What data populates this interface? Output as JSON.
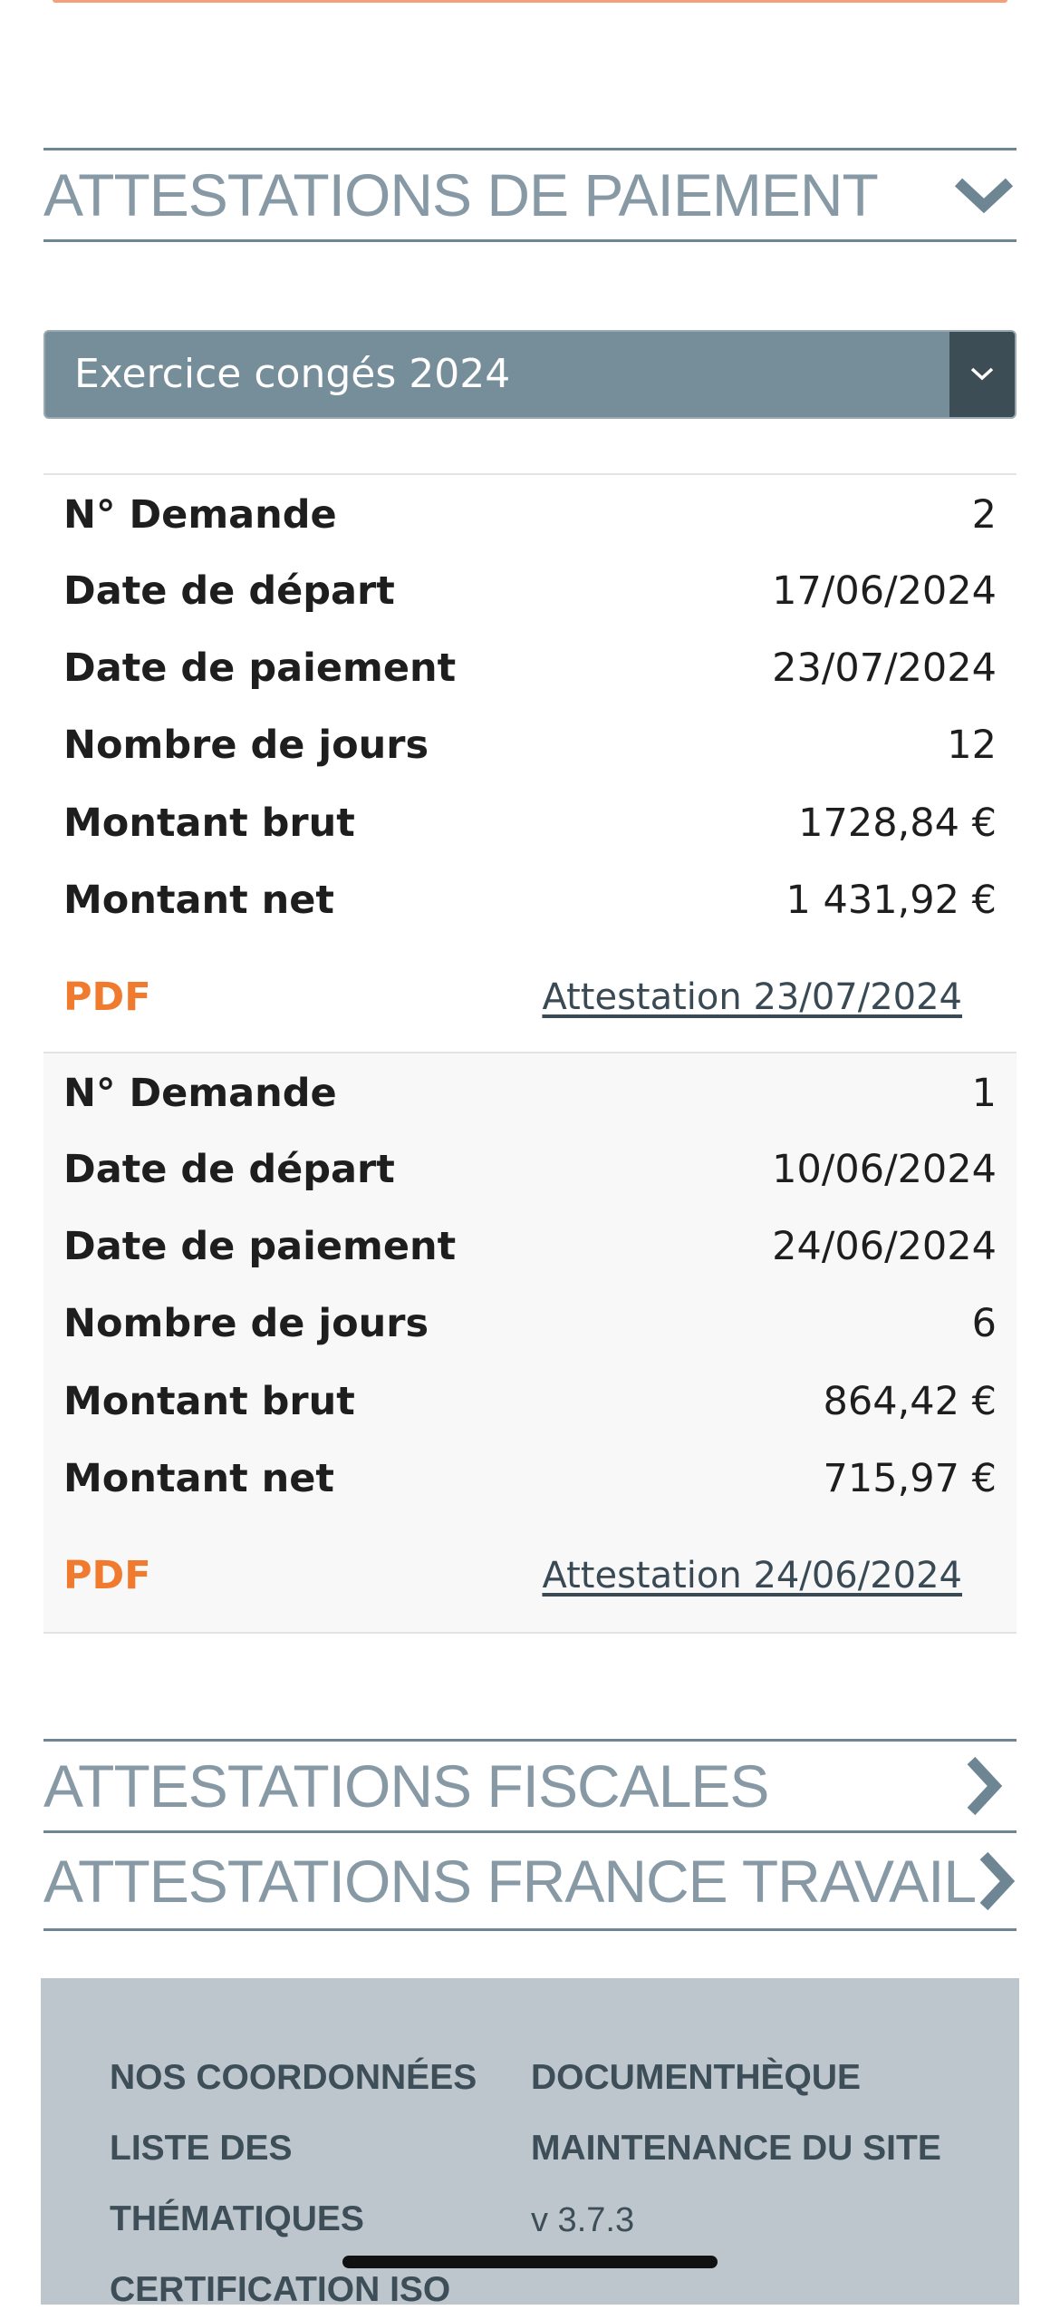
{
  "sections": {
    "payment": {
      "title": "ATTESTATIONS DE PAIEMENT",
      "icon": "chevron-down-icon"
    },
    "fiscal": {
      "title": "ATTESTATIONS FISCALES",
      "icon": "chevron-right-icon"
    },
    "france_travail": {
      "title": "ATTESTATIONS FRANCE TRAVAIL",
      "icon": "chevron-right-icon"
    }
  },
  "exercise_select": {
    "value": "Exercice congés 2024",
    "icon": "chevron-down-icon"
  },
  "labels": {
    "request_no": "N° Demande",
    "departure_date": "Date de départ",
    "payment_date": "Date de paiement",
    "days_count": "Nombre de jours",
    "gross_amount": "Montant brut",
    "net_amount": "Montant net",
    "pdf": "PDF"
  },
  "requests": [
    {
      "request_no": "2",
      "departure_date": "17/06/2024",
      "payment_date": "23/07/2024",
      "days_count": "12",
      "gross_amount": "1728,84 €",
      "net_amount": "1 431,92 €",
      "attestation_link": "Attestation 23/07/2024"
    },
    {
      "request_no": "1",
      "departure_date": "10/06/2024",
      "payment_date": "24/06/2024",
      "days_count": "6",
      "gross_amount": "864,42 €",
      "net_amount": "715,97 €",
      "attestation_link": "Attestation 24/06/2024"
    }
  ],
  "footer": {
    "left": [
      "NOS COORDONNÉES",
      "LISTE DES",
      "THÉMATIQUES",
      "CERTIFICATION ISO"
    ],
    "right": [
      "DOCUMENTHÈQUE",
      "MAINTENANCE DU SITE"
    ],
    "version": "v 3.7.3"
  },
  "colors": {
    "section_title": "#8699a5",
    "section_border": "#6e8694",
    "select_bg": "#768e9a",
    "select_button": "#3d4d56",
    "pdf_accent": "#f07a2e",
    "footer_bg": "#bcc6cc"
  }
}
